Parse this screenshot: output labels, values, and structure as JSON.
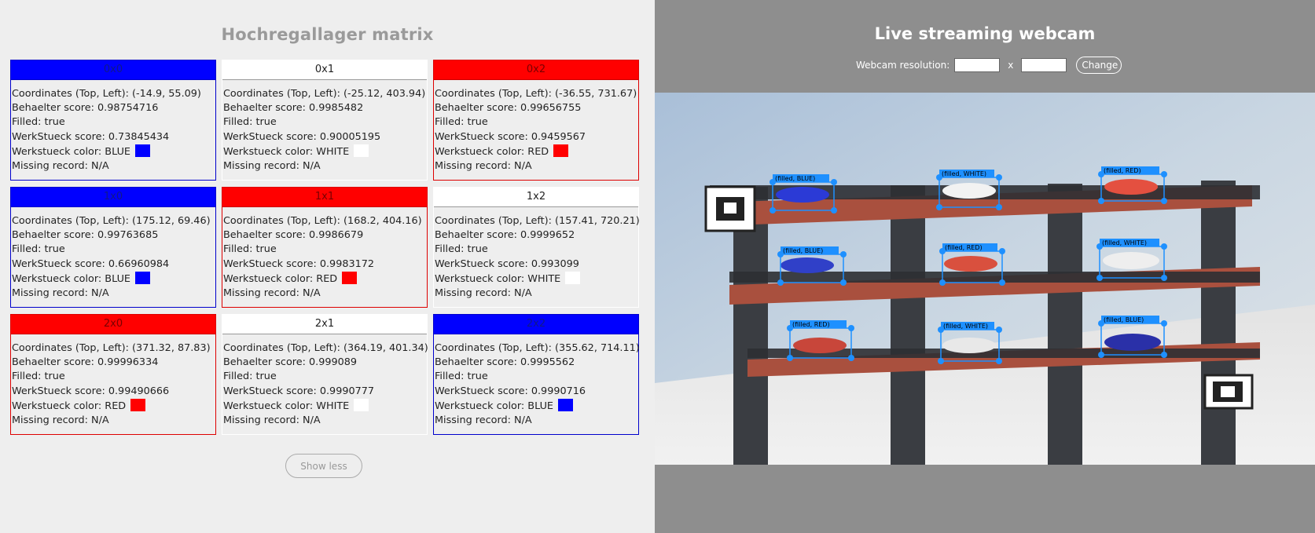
{
  "left": {
    "title": "Hochregallager matrix",
    "cells": [
      {
        "id": "0x0",
        "coords": "Coordinates (Top, Left): (-14.9, 55.09)",
        "behaelter": "Behaelter score: 0.98754716",
        "filled": "Filled: true",
        "werkstueck_score": "WerkStueck score: 0.73845434",
        "color_label": "Werkstueck color: BLUE",
        "color": "blue",
        "missing": "Missing record: N/A"
      },
      {
        "id": "0x1",
        "coords": "Coordinates (Top, Left): (-25.12, 403.94)",
        "behaelter": "Behaelter score: 0.9985482",
        "filled": "Filled: true",
        "werkstueck_score": "WerkStueck score: 0.90005195",
        "color_label": "Werkstueck color: WHITE",
        "color": "white",
        "missing": "Missing record: N/A"
      },
      {
        "id": "0x2",
        "coords": "Coordinates (Top, Left): (-36.55, 731.67)",
        "behaelter": "Behaelter score: 0.99656755",
        "filled": "Filled: true",
        "werkstueck_score": "WerkStueck score: 0.9459567",
        "color_label": "Werkstueck color: RED",
        "color": "red",
        "missing": "Missing record: N/A"
      },
      {
        "id": "1x0",
        "coords": "Coordinates (Top, Left): (175.12, 69.46)",
        "behaelter": "Behaelter score: 0.99763685",
        "filled": "Filled: true",
        "werkstueck_score": "WerkStueck score: 0.66960984",
        "color_label": "Werkstueck color: BLUE",
        "color": "blue",
        "missing": "Missing record: N/A"
      },
      {
        "id": "1x1",
        "coords": "Coordinates (Top, Left): (168.2, 404.16)",
        "behaelter": "Behaelter score: 0.9986679",
        "filled": "Filled: true",
        "werkstueck_score": "WerkStueck score: 0.9983172",
        "color_label": "Werkstueck color: RED",
        "color": "red",
        "missing": "Missing record: N/A"
      },
      {
        "id": "1x2",
        "coords": "Coordinates (Top, Left): (157.41, 720.21)",
        "behaelter": "Behaelter score: 0.9999652",
        "filled": "Filled: true",
        "werkstueck_score": "WerkStueck score: 0.993099",
        "color_label": "Werkstueck color: WHITE",
        "color": "white",
        "missing": "Missing record: N/A"
      },
      {
        "id": "2x0",
        "coords": "Coordinates (Top, Left): (371.32, 87.83)",
        "behaelter": "Behaelter score: 0.99996334",
        "filled": "Filled: true",
        "werkstueck_score": "WerkStueck score: 0.99490666",
        "color_label": "Werkstueck color: RED",
        "color": "red",
        "missing": "Missing record: N/A"
      },
      {
        "id": "2x1",
        "coords": "Coordinates (Top, Left): (364.19, 401.34)",
        "behaelter": "Behaelter score: 0.999089",
        "filled": "Filled: true",
        "werkstueck_score": "WerkStueck score: 0.9990777",
        "color_label": "Werkstueck color: WHITE",
        "color": "white",
        "missing": "Missing record: N/A"
      },
      {
        "id": "2x2",
        "coords": "Coordinates (Top, Left): (355.62, 714.11)",
        "behaelter": "Behaelter score: 0.9995562",
        "filled": "Filled: true",
        "werkstueck_score": "WerkStueck score: 0.9990716",
        "color_label": "Werkstueck color: BLUE",
        "color": "blue",
        "missing": "Missing record: N/A"
      }
    ],
    "show_less_label": "Show less"
  },
  "right": {
    "title": "Live streaming webcam",
    "resolution_label": "Webcam resolution:",
    "width_value": "",
    "height_value": "",
    "x_label": "x",
    "change_label": "Change",
    "detections": [
      {
        "label": "(filled, BLUE)"
      },
      {
        "label": "(filled, WHITE)"
      },
      {
        "label": "(filled, RED)"
      },
      {
        "label": "(filled, BLUE)"
      },
      {
        "label": "(filled, RED)"
      },
      {
        "label": "(filled, WHITE)"
      },
      {
        "label": "(filled, RED)"
      },
      {
        "label": "(filled, WHITE)"
      },
      {
        "label": "(filled, BLUE)"
      }
    ]
  },
  "colors": {
    "blue": "#0000ff",
    "red": "#ff0000",
    "white": "#ffffff",
    "detection_box": "#1e90ff",
    "left_bg": "#eeeeee",
    "right_bg": "#8e8e8e"
  }
}
